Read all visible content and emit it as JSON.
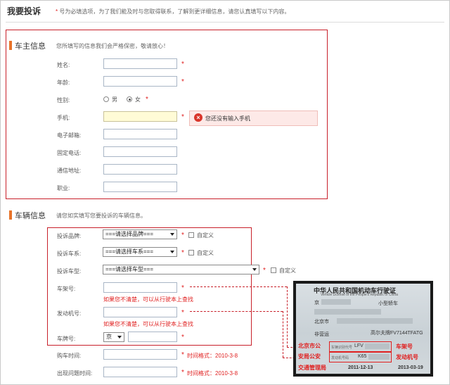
{
  "header": {
    "title": "我要投诉",
    "desc_star": "*",
    "desc": "号为必填选项，为了我们能及时与您取得联系，了解到更详细信息，请您认真填写以下内容。"
  },
  "owner_section": {
    "title": "车主信息",
    "desc": "您所填写的信息我们会严格保密，敬请放心！",
    "fields": [
      {
        "label": "姓名:",
        "value": "",
        "required": "*"
      },
      {
        "label": "年龄:",
        "value": "",
        "required": "*"
      },
      {
        "label": "性别:"
      },
      {
        "label": "手机:",
        "value": "",
        "required": "*"
      },
      {
        "label": "电子邮箱:",
        "value": ""
      },
      {
        "label": "固定电话:",
        "value": ""
      },
      {
        "label": "通信地址:",
        "value": ""
      },
      {
        "label": "职业:",
        "value": ""
      }
    ],
    "gender": {
      "male": "男",
      "female": "女",
      "selected": "女",
      "required": "*"
    },
    "error": {
      "icon": "error-icon",
      "text": "您还没有输入手机"
    }
  },
  "vehicle_section": {
    "title": "车辆信息",
    "desc": "请您如实填写您要投诉的车辆信息。",
    "brand": {
      "label": "投诉品牌:",
      "value": "===请选择品牌===",
      "required": "*",
      "custom": "自定义"
    },
    "series": {
      "label": "投诉车系:",
      "value": "===请选择车系===",
      "required": "*",
      "custom": "自定义"
    },
    "model": {
      "label": "投诉车型:",
      "value": "===请选择车型===",
      "required": "*",
      "custom": "自定义"
    },
    "vin": {
      "label": "车架号:",
      "value": "",
      "required": "*",
      "hint": "如果您不清楚，可以从行驶本上查找"
    },
    "engine": {
      "label": "发动机号:",
      "value": "",
      "required": "*",
      "hint": "如果您不清楚，可以从行驶本上查找"
    },
    "plate": {
      "label": "车牌号:",
      "prefix": "京",
      "value": "",
      "required": "*"
    },
    "purchase_time": {
      "label": "购车时间:",
      "value": "",
      "required": "*",
      "hint": "时间格式：2010-3-8"
    },
    "issue_time": {
      "label": "出现问题时间:",
      "value": "",
      "required": "*",
      "hint": "时间格式：2010-3-8"
    }
  },
  "license_image": {
    "title": "中华人民共和国机动车行驶证",
    "subtitle": "Vehicle License of the People's Republic of China",
    "city": "京",
    "vehicle_type": "小型轿车",
    "address": "北京市",
    "use_nature": "非营运",
    "model": "高尔夫牌FV7144TFATG",
    "vin_label": "车辆识别代号",
    "vin_partial": "LFV",
    "engine_label": "发动机号码",
    "engine_partial": "K65",
    "stamp_line1": "北京市公",
    "stamp_line2": "安局公安",
    "stamp_line3": "交通管理局",
    "register_date": "2011-12-13",
    "issue_date": "2013-03-19",
    "vin_callout": "车架号",
    "engine_callout": "发动机号"
  },
  "colors": {
    "accent": "#e8742a",
    "highlight_box": "#c8202a",
    "required": "#e02020"
  }
}
